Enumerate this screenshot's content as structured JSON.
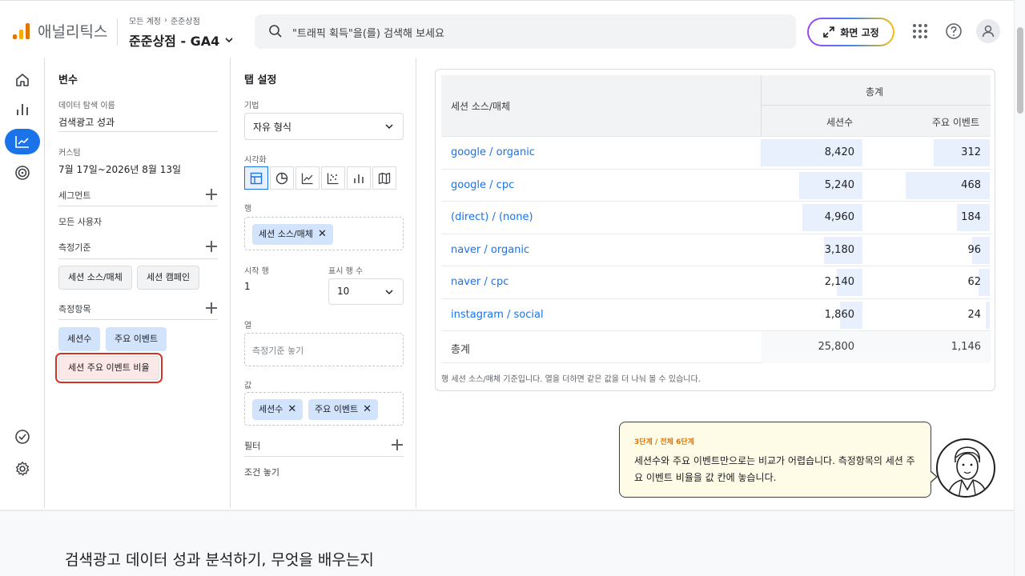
{
  "app": {
    "brand": "애널리틱스",
    "breadcrumb_parent": "모든 계정",
    "breadcrumb_child": "준준상점",
    "property": "준준상점 - GA4"
  },
  "search": {
    "placeholder": "\"트래픽 획득\"을(를) 검색해 보세요"
  },
  "toolbar": {
    "pin_label": "화면 고정"
  },
  "nav": {
    "items": [
      "home-icon",
      "bar-chart-icon",
      "explore-icon",
      "advertising-icon",
      "check-circle-icon",
      "gear-icon"
    ],
    "active": 2
  },
  "variables": {
    "title": "변수",
    "exploration_name_label": "데이터 탐색 이름",
    "exploration_name": "검색광고 성과",
    "custom_label": "커스텀",
    "date_range": "7월 17일~2026년 8월 13일",
    "segments_label": "세그먼트",
    "segment_value": "모든 사용자",
    "dimensions_label": "측정기준",
    "dimensions": [
      "세션 소스/매체",
      "세션 캠페인"
    ],
    "metrics_label": "측정항목",
    "metrics": [
      "세션수",
      "주요 이벤트"
    ],
    "metric_highlighted": "세션 주요 이벤트 비율"
  },
  "tab_settings": {
    "title": "탭 설정",
    "technique_label": "기법",
    "technique": "자유 형식",
    "viz_label": "시각화",
    "viz_icons": [
      "table-icon",
      "donut-icon",
      "line-icon",
      "scatter-icon",
      "bar-icon",
      "map-icon"
    ],
    "rows_label": "행",
    "rows_chip": "세션 소스/매체",
    "start_row_label": "시작 행",
    "start_row": "1",
    "show_rows_label": "표시 행 수",
    "show_rows": "10",
    "columns_label": "열",
    "columns_placeholder": "측정기준 놓기",
    "values_label": "값",
    "values_chips": [
      "세션수",
      "주요 이벤트"
    ],
    "filter_label": "필터",
    "filter_placeholder": "조건 놓기"
  },
  "table": {
    "dimension_header": "세션 소스/매체",
    "totals_header": "총계",
    "metric_headers": [
      "세션수",
      "주요 이벤트"
    ],
    "rows": [
      {
        "source": "google / organic",
        "sessions": "8,420",
        "events": "312",
        "s": 8420,
        "e": 312
      },
      {
        "source": "google / cpc",
        "sessions": "5,240",
        "events": "468",
        "s": 5240,
        "e": 468
      },
      {
        "source": "(direct) / (none)",
        "sessions": "4,960",
        "events": "184",
        "s": 4960,
        "e": 184
      },
      {
        "source": "naver / organic",
        "sessions": "3,180",
        "events": "96",
        "s": 3180,
        "e": 96
      },
      {
        "source": "naver / cpc",
        "sessions": "2,140",
        "events": "62",
        "s": 2140,
        "e": 62
      },
      {
        "source": "instagram / social",
        "sessions": "1,860",
        "events": "24",
        "s": 1860,
        "e": 24
      }
    ],
    "total_label": "총계",
    "total_sessions": "25,800",
    "total_events": "1,146",
    "footnote": "행 세션 소스/매체 기준입니다. 열을 더하면 같은 값을 더 나눠 볼 수 있습니다."
  },
  "tooltip": {
    "step": "3단계 / 전체 6단계",
    "message": "세션수와 주요 이벤트만으로는 비교가 어렵습니다. 측정항목의 세션 주요 이벤트 비율을 값 칸에 놓습니다."
  },
  "bottom": {
    "heading": "검색광고 데이터 성과 분석하기, 무엇을 배우는지"
  },
  "colors": {
    "accent": "#1a73e8",
    "bar_fill": "#e8f0fe",
    "highlight": "#d93025",
    "tooltip_bg": "#fefbe6"
  }
}
